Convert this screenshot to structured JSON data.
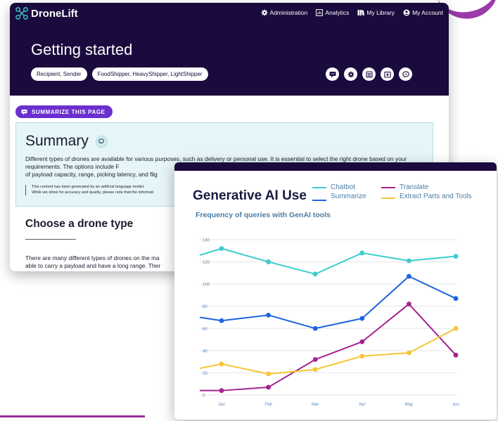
{
  "app": {
    "brand": "DroneLift",
    "nav": [
      {
        "label": "Administration",
        "icon": "gear-icon"
      },
      {
        "label": "Analytics",
        "icon": "chart-icon"
      },
      {
        "label": "My Library",
        "icon": "library-icon"
      },
      {
        "label": "My Account",
        "icon": "account-icon"
      }
    ],
    "page_title": "Getting started",
    "chips": [
      "Recipient, Sender",
      "FoodShipper, HeavyShipper, LightShipper"
    ],
    "hero_actions": [
      "chat-icon",
      "gear-icon",
      "list-icon",
      "download-icon",
      "feedback-icon"
    ],
    "summarize_button": "SUMMARIZE THIS PAGE",
    "summary": {
      "title": "Summary",
      "text": "Different types of drones are available for various purposes, such as delivery or personal use. It is essential to select the right drone based on your requirements. The options include F",
      "text_line3": "of payload capacity, range, picking latency, and flig",
      "disclaimer_1": "This content has been generated by an artificial language model.",
      "disclaimer_2": "While we strive for accuracy and quality, please note that the informati"
    },
    "section_title": "Choose a drone type",
    "body_text_1": "There are many different types of drones on the ma",
    "body_text_2": "able to carry a payload and have a long range. Ther"
  },
  "chart_data": {
    "type": "line",
    "title": "Generative AI Use",
    "subtitle": "Frequency of queries with GenAI tools",
    "categories": [
      "Jan",
      "Feb",
      "Mar",
      "Apr",
      "May",
      "Jun"
    ],
    "ylim": [
      0,
      140
    ],
    "yticks": [
      0,
      20,
      40,
      60,
      80,
      100,
      120,
      140
    ],
    "grid": true,
    "legend_position": "top-right",
    "series": [
      {
        "name": "Chatbot",
        "color": "#3ccccc",
        "values": [
          132,
          120,
          109,
          128,
          121,
          125
        ],
        "start": 126
      },
      {
        "name": "Translate",
        "color": "#a3238f",
        "values": [
          4,
          7,
          32,
          48,
          82,
          36
        ],
        "start": 4
      },
      {
        "name": "Summarize",
        "color": "#1e63e0",
        "values": [
          67,
          72,
          60,
          69,
          107,
          87
        ],
        "start": 70
      },
      {
        "name": "Extract Parts and Tools",
        "color": "#f7c534",
        "values": [
          28,
          19,
          23,
          35,
          38,
          60
        ],
        "start": 24
      }
    ]
  }
}
